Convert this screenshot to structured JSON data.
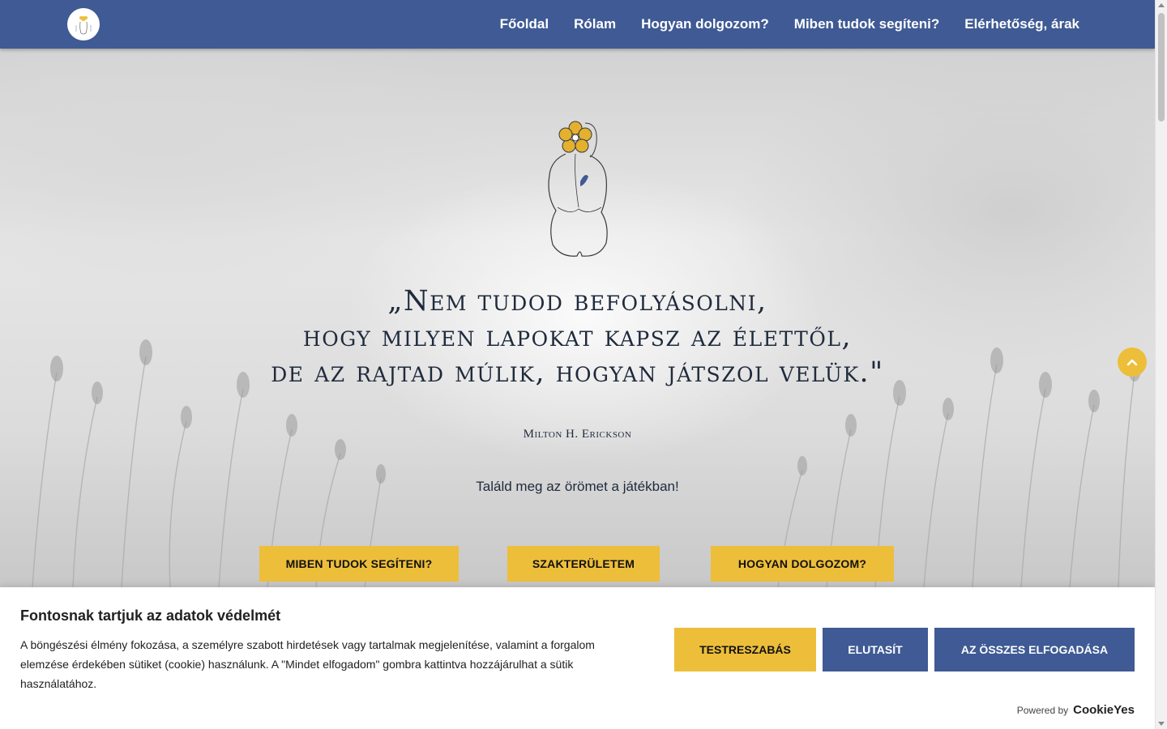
{
  "header": {
    "nav": [
      {
        "label": "Főoldal"
      },
      {
        "label": "Rólam"
      },
      {
        "label": "Hogyan dolgozom?"
      },
      {
        "label": "Miben tudok segíteni?"
      },
      {
        "label": "Elérhetőség, árak"
      }
    ]
  },
  "hero": {
    "quote_lines": [
      "„Nem tudod befolyásolni,",
      "hogy milyen lapokat kapsz az élettől,",
      "de az rajtad múlik, hogyan játszol velük.\""
    ],
    "author": "Milton H. Erickson",
    "tagline": "Találd meg az örömet a játékban!",
    "buttons": [
      {
        "label": "Miben tudok segíteni?"
      },
      {
        "label": "Szakterületem"
      },
      {
        "label": "Hogyan dolgozom?"
      }
    ]
  },
  "cookie": {
    "title": "Fontosnak tartjuk az adatok védelmét",
    "text": "A böngészési élmény fokozása, a személyre szabott hirdetések vagy tartalmak megjelenítése, valamint a forgalom elemzése érdekében sütiket (cookie) használunk. A \"Mindet elfogadom\" gombra kattintva hozzájárulhat a sütik használatához.",
    "buttons": {
      "customize": "Testreszabás",
      "reject": "Elutasít",
      "accept_all": "Az összes elfogadása"
    },
    "powered_label": "Powered by",
    "powered_brand": "CookieYes"
  },
  "icons": {
    "back_to_top": "chevron-up-icon",
    "logo": "flower-figure-logo"
  },
  "colors": {
    "header_bg": "#3f5a94",
    "accent_yellow": "#edbe3a",
    "text_dark": "#1f2a3c"
  }
}
